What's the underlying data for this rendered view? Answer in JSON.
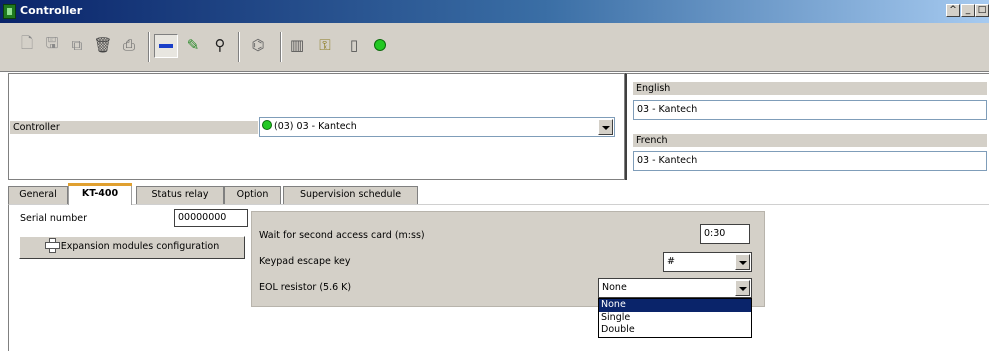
{
  "window": {
    "title": "Controller"
  },
  "titlebar_buttons": [
    "restore-icon",
    "minimize-icon",
    "maximize-icon",
    "close-icon"
  ],
  "toolbar": {
    "icons": [
      "new-icon",
      "save-icon",
      "copy-icon",
      "delete-icon",
      "print-icon",
      "link-icon",
      "edit-icon",
      "find-icon",
      "report-icon",
      "door-icon",
      "key-icon",
      "card-reader-icon",
      "status-icon"
    ],
    "status_color": "#23c823"
  },
  "header": {
    "controller_label": "Controller",
    "controller_value": "(03) 03 - Kantech",
    "english_label": "English",
    "english_value": "03 - Kantech",
    "french_label": "French",
    "french_value": "03 - Kantech"
  },
  "tabs": [
    {
      "label": "General",
      "active": false
    },
    {
      "label": "KT-400",
      "active": true
    },
    {
      "label": "Status relay",
      "active": false
    },
    {
      "label": "Option",
      "active": false
    },
    {
      "label": "Supervision schedule",
      "active": false
    }
  ],
  "kt400": {
    "serial_label": "Serial number",
    "serial_value": "00000000",
    "expansion_button": "Expansion modules configuration",
    "wait_label": "Wait for second access card (m:ss)",
    "wait_value": "0:30",
    "keypad_label": "Keypad escape key",
    "keypad_value": "#",
    "eol_label": "EOL resistor (5.6 K)",
    "eol_value": "None",
    "eol_options": [
      "None",
      "Single",
      "Double"
    ],
    "eol_selected": "None"
  },
  "colors": {
    "selection": "#0a246a",
    "tab_accent": "#e0a030",
    "panel": "#d4d0c8"
  }
}
